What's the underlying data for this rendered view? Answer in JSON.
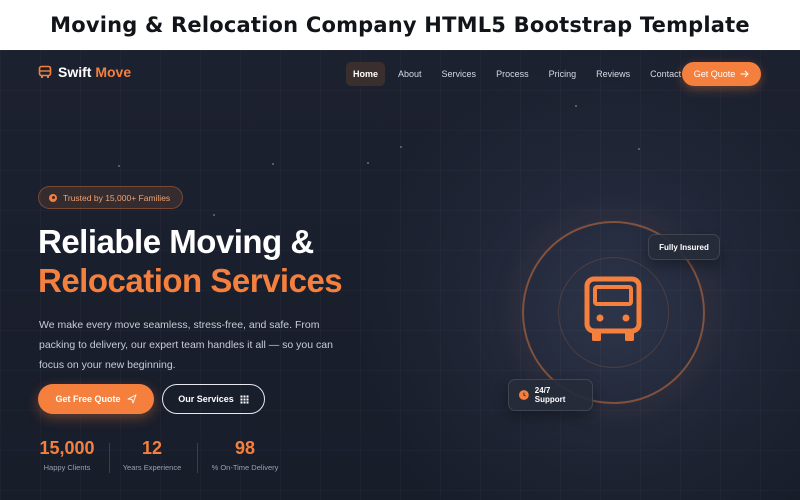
{
  "banner": {
    "title": "Moving & Relocation Company HTML5 Bootstrap Template"
  },
  "brand": {
    "name_part1": "Swift",
    "name_part2": "Move",
    "logo_icon": "truck-icon"
  },
  "nav": {
    "items": [
      {
        "label": "Home",
        "active": true
      },
      {
        "label": "About"
      },
      {
        "label": "Services"
      },
      {
        "label": "Process"
      },
      {
        "label": "Pricing"
      },
      {
        "label": "Reviews"
      },
      {
        "label": "Contact"
      }
    ],
    "cta_label": "Get Quote",
    "cta_icon": "arrow-right-icon"
  },
  "hero": {
    "badge": "Trusted by 15,000+ Families",
    "headline_line1": "Reliable Moving &",
    "headline_line2": "Relocation Services",
    "description": "We make every move seamless, stress-free, and safe. From packing to delivery, our expert team handles it all — so you can focus on your new beginning.",
    "primary_button": "Get Free Quote",
    "primary_icon": "send-icon",
    "secondary_button": "Our Services",
    "secondary_icon": "grid-icon"
  },
  "stats": [
    {
      "value": "15,000",
      "label": "Happy Clients"
    },
    {
      "value": "12",
      "label": "Years Experience"
    },
    {
      "value": "98",
      "label": "% On-Time Delivery"
    }
  ],
  "illustration": {
    "icon": "bus-icon",
    "card_insured": "Fully Insured",
    "card_support": "24/7 Support",
    "support_icon": "clock-icon"
  },
  "colors": {
    "accent": "#f5803e",
    "background": "#1c2130",
    "text": "#ffffff"
  }
}
